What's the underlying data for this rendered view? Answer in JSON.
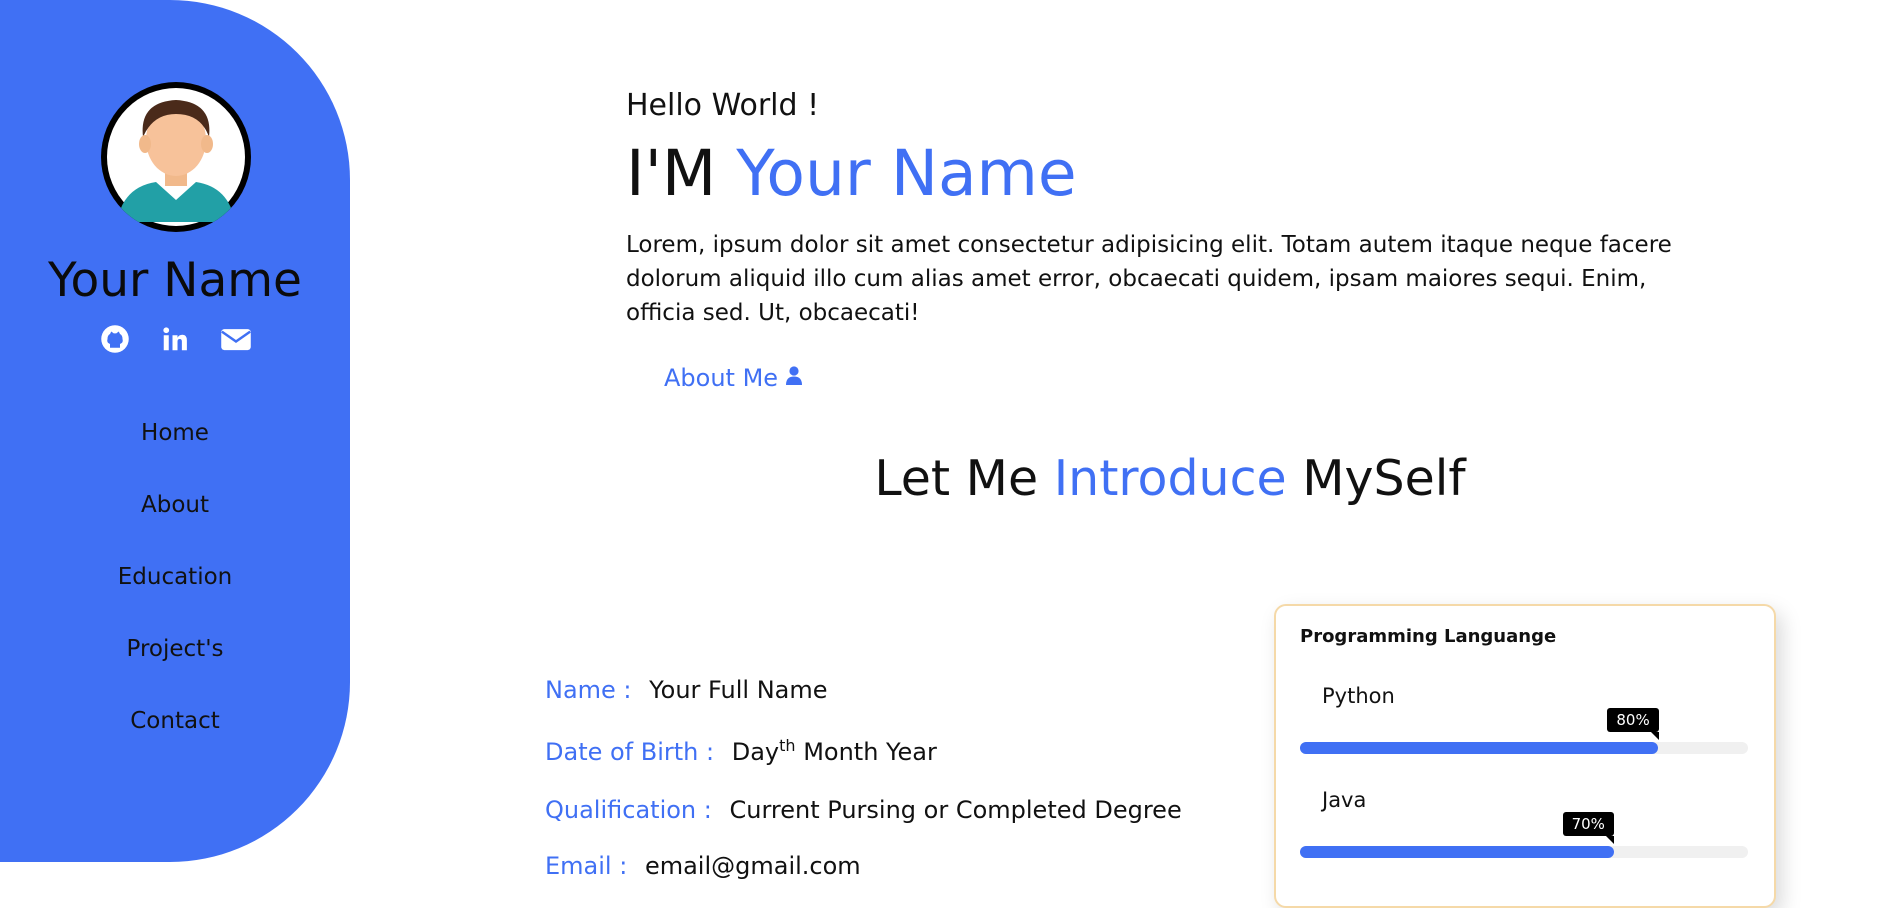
{
  "sidebar": {
    "name": "Your Name",
    "nav": [
      {
        "label": "Home"
      },
      {
        "label": "About"
      },
      {
        "label": "Education"
      },
      {
        "label": "Project's"
      },
      {
        "label": "Contact"
      }
    ],
    "icons": [
      "github-icon",
      "linkedin-icon",
      "envelope-icon"
    ]
  },
  "hero": {
    "greeting": "Hello World !",
    "prefix": "I'M",
    "name": "Your Name",
    "text": "Lorem, ipsum dolor sit amet consectetur adipisicing elit. Totam autem itaque neque facere dolorum aliquid illo cum alias amet error, obcaecati quidem, ipsam maiores sequi. Enim, officia sed. Ut, obcaecati!",
    "about_label": "About Me"
  },
  "section": {
    "title_part1": "Let Me",
    "title_accent": "Introduce",
    "title_part2": "MySelf"
  },
  "info": {
    "name_label": "Name :",
    "name_value": "Your Full Name",
    "dob_label": "Date of Birth :",
    "dob_day": "Day",
    "dob_sup": "th",
    "dob_rest": "Month Year",
    "qual_label": "Qualification :",
    "qual_value": "Current Pursing or Completed Degree",
    "email_label": "Email :",
    "email_value": "email@gmail.com"
  },
  "skills": {
    "title": "Programming Languange",
    "items": [
      {
        "name": "Python",
        "percent": 80,
        "label": "80%"
      },
      {
        "name": "Java",
        "percent": 70,
        "label": "70%"
      }
    ]
  },
  "colors": {
    "accent": "#4070f4",
    "text": "#111111",
    "card_border": "#f5d9a8"
  }
}
